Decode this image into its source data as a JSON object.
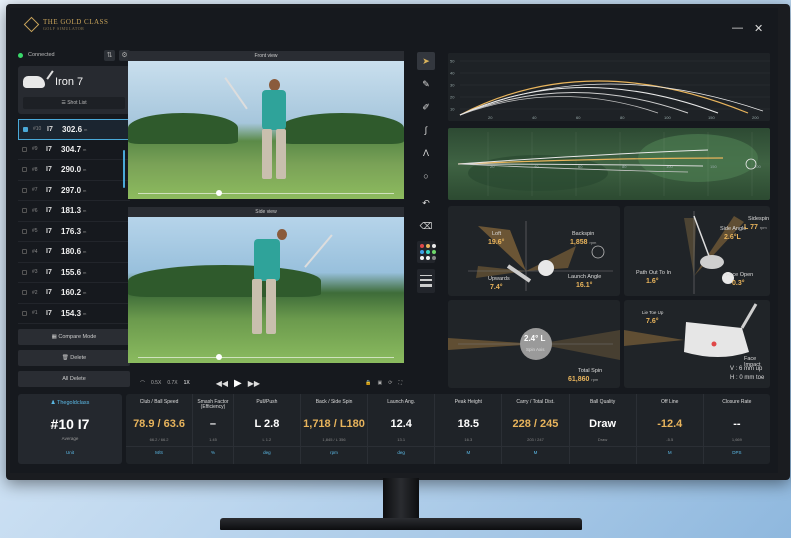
{
  "app": {
    "brand": "THE GOLD CLASS",
    "brand_sub": "GOLF SIMULATOR",
    "minimize": "—",
    "close": "✕"
  },
  "left_panel": {
    "status": "Connected",
    "club": "Iron 7",
    "shot_list_label": "Shot List",
    "shots": [
      {
        "num": "#10",
        "club": "I7",
        "distance": "302.6",
        "unit": "m",
        "active": true
      },
      {
        "num": "#9",
        "club": "I7",
        "distance": "304.7",
        "unit": "m",
        "active": false
      },
      {
        "num": "#8",
        "club": "I7",
        "distance": "290.0",
        "unit": "m",
        "active": false
      },
      {
        "num": "#7",
        "club": "I7",
        "distance": "297.0",
        "unit": "m",
        "active": false
      },
      {
        "num": "#6",
        "club": "I7",
        "distance": "181.3",
        "unit": "m",
        "active": false
      },
      {
        "num": "#5",
        "club": "I7",
        "distance": "176.3",
        "unit": "m",
        "active": false
      },
      {
        "num": "#4",
        "club": "I7",
        "distance": "180.6",
        "unit": "m",
        "active": false
      },
      {
        "num": "#3",
        "club": "I7",
        "distance": "155.6",
        "unit": "m",
        "active": false
      },
      {
        "num": "#2",
        "club": "I7",
        "distance": "160.2",
        "unit": "m",
        "active": false
      },
      {
        "num": "#1",
        "club": "I7",
        "distance": "154.3",
        "unit": "m",
        "active": false
      }
    ],
    "compare_mode": "Compare Mode",
    "delete": "Delete",
    "all_delete": "All Delete"
  },
  "videos": {
    "front_title": "Front view",
    "side_title": "Side view"
  },
  "playback": {
    "speeds": [
      "0.5X",
      "0.7X",
      "1X"
    ],
    "rewind": "◀◀",
    "play": "▶",
    "forward": "▶▶"
  },
  "tools": {
    "icons": [
      "cursor-icon",
      "pencil-icon",
      "pen-icon",
      "curve-icon",
      "angle-icon",
      "circle-icon",
      "undo-icon",
      "eraser-icon"
    ],
    "glyphs": [
      "➤",
      "✎",
      "✐",
      "∫",
      "Λ",
      "○",
      "↶",
      "⌫"
    ],
    "colors": [
      "#e04848",
      "#e8b45c",
      "#e8e8e8",
      "#3fa0e8",
      "#39d8c2",
      "#6fd86a",
      "#f2f2f2",
      "#f2f2f2",
      "#888888"
    ],
    "line_widths": [
      "1",
      "2",
      "3"
    ]
  },
  "trajectory": {
    "y_ticks": [
      "50",
      "40",
      "30",
      "20",
      "10"
    ],
    "x_ticks": [
      "20",
      "40",
      "60",
      "80",
      "100",
      "150",
      "200"
    ]
  },
  "overhead": {
    "x_ticks": [
      "20",
      "40",
      "60",
      "80",
      "100",
      "150",
      "200"
    ]
  },
  "metrics": {
    "loft_label": "Loft",
    "loft_value": "19.6°",
    "backspin_label": "Backspin",
    "backspin_value": "1,858",
    "backspin_unit": "rpm",
    "upwards_label": "Upwards",
    "upwards_value": "7.4°",
    "launch_angle_label": "Launch Angle",
    "launch_angle_value": "16.1°",
    "side_angle_label": "Side Angle",
    "side_angle_value": "2.6°L",
    "sidespin_label": "Sidespin",
    "sidespin_value": "L 77",
    "sidespin_unit": "rpm",
    "path_label": "Path Out To In",
    "path_value": "1.6°",
    "face_open_label": "Face Open",
    "face_open_value": "0.3°",
    "spin_axis_value": "2.4° L",
    "spin_axis_label": "Spin Axis",
    "total_spin_label": "Total Spin",
    "total_spin_value": "61,860",
    "total_spin_unit": "rpm",
    "lie_label": "Lie Toe Up",
    "lie_value": "7.6°",
    "face_impact_label": "Face Impact",
    "face_impact_v": "V : 6 mm up",
    "face_impact_h": "H : 0 mm toe"
  },
  "stats": {
    "player": {
      "name": "Thegoldclass",
      "shot": "#10 I7",
      "avg_label": "Average",
      "unit_label": "Unit"
    },
    "columns": [
      {
        "head": "Club / Ball Speed",
        "value": "78.9 / 63.6",
        "sub": "66.2 / 66.2",
        "unit": "M/S",
        "gold": true
      },
      {
        "head": "Smash Factor (Efficiency)",
        "value": "–",
        "sub": "1.45",
        "unit": "%",
        "gold": false
      },
      {
        "head": "Pull/Push",
        "value": "L 2.8",
        "sub": "L 1.2",
        "unit": "deg",
        "gold": false
      },
      {
        "head": "Back / Side Spin",
        "value": "1,718 / L180",
        "sub": "1,845 / L 356",
        "unit": "rpm",
        "gold": true
      },
      {
        "head": "Launch Ang.",
        "value": "12.4",
        "sub": "13.1",
        "unit": "deg",
        "gold": false
      },
      {
        "head": "Peak Height",
        "value": "18.5",
        "sub": "16.3",
        "unit": "M",
        "gold": false
      },
      {
        "head": "Carry / Total Dist.",
        "value": "228 / 245",
        "sub": "203 / 247",
        "unit": "M",
        "gold": true
      },
      {
        "head": "Ball Quality",
        "value": "Draw",
        "sub": "Draw",
        "unit": "",
        "gold": false
      },
      {
        "head": "Off Line",
        "value": "-12.4",
        "sub": "-5.5",
        "unit": "M",
        "gold": true
      },
      {
        "head": "Closure Rate",
        "value": "--",
        "sub": "1,669",
        "unit": "DPS",
        "gold": false
      }
    ]
  }
}
